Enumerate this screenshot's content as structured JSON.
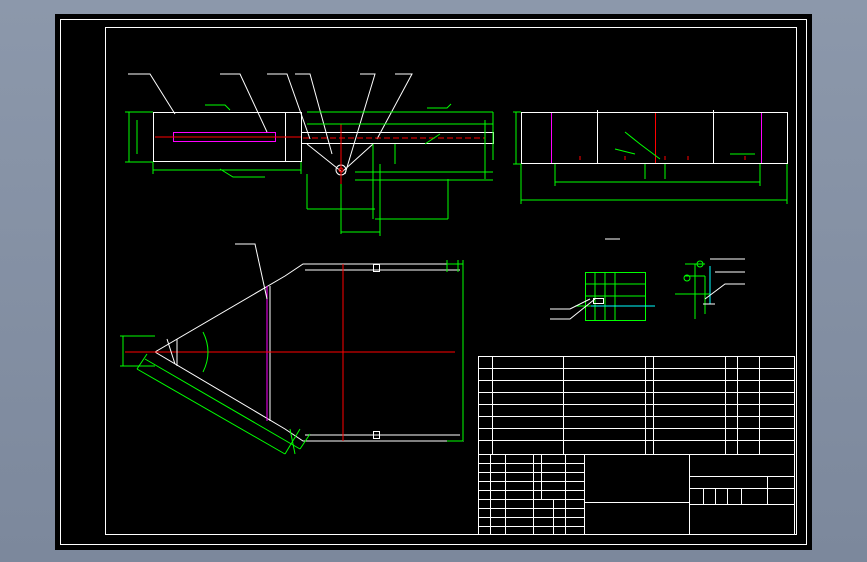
{
  "viewport": {
    "background": "#000000",
    "surround": "#8393a7"
  },
  "colors": {
    "frame": "#ffffff",
    "outline": "#ffffff",
    "dimension": "#00ff00",
    "centerline": "#ff0000",
    "hidden": "#ff00ff",
    "leader": "#ffffff",
    "accent_cyan": "#00ffff"
  },
  "drawing": {
    "views": [
      "front-view",
      "right-side-view",
      "plan-view",
      "detail-view-a",
      "detail-view-b"
    ],
    "title_block": {
      "revision_table_rows": 11,
      "left_grid_rows": 9,
      "bottom_right_cells": 6
    }
  }
}
